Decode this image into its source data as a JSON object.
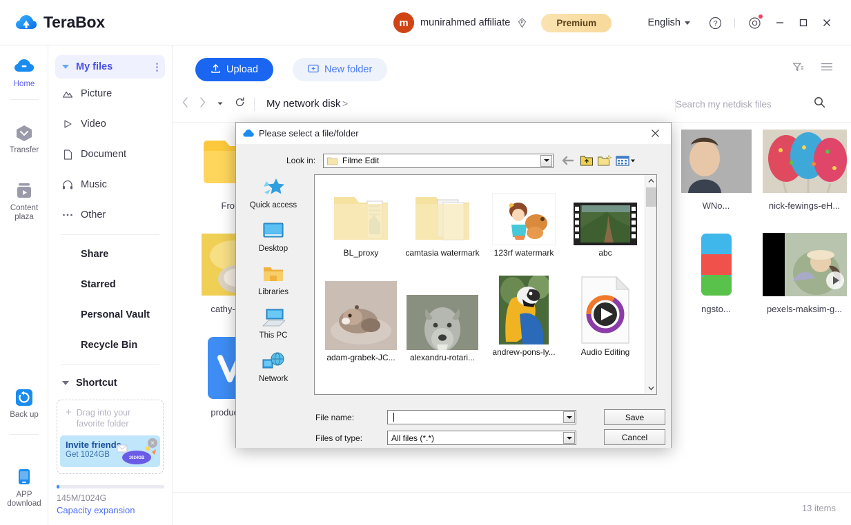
{
  "app": {
    "brand": "TeraBox",
    "brand_color": "#1a8cf0"
  },
  "topbar": {
    "avatar_initial": "m",
    "account_name": "munirahmed affiliate",
    "premium_label": "Premium",
    "language": "English",
    "icons": [
      "help-icon",
      "settings-icon"
    ],
    "window_controls": [
      "minimize",
      "maximize",
      "close"
    ]
  },
  "rail": {
    "items": [
      {
        "label": "Home",
        "icon": "cloud-icon",
        "active": true
      },
      {
        "label": "Transfer",
        "icon": "transfer-icon",
        "active": false
      },
      {
        "label": "Content plaza",
        "icon": "content-plaza-icon",
        "active": false
      },
      {
        "label": "Back up",
        "icon": "backup-icon",
        "active": false
      },
      {
        "label": "APP download",
        "icon": "app-download-icon",
        "active": false
      }
    ]
  },
  "sidebar": {
    "my_files": "My files",
    "categories": [
      {
        "label": "Picture",
        "icon": "picture-icon"
      },
      {
        "label": "Video",
        "icon": "video-icon"
      },
      {
        "label": "Document",
        "icon": "document-icon"
      },
      {
        "label": "Music",
        "icon": "music-icon"
      },
      {
        "label": "Other",
        "icon": "other-icon"
      }
    ],
    "links": [
      "Share",
      "Starred",
      "Personal Vault",
      "Recycle Bin"
    ],
    "shortcut": "Shortcut",
    "dropzone": "Drag into your favorite folder",
    "invite_title": "Invite friends",
    "invite_sub": "Get 1024GB",
    "invite_art_label": "1024GB",
    "capacity_text": "145M/1024G",
    "capacity_link": "Capacity expansion"
  },
  "main": {
    "upload_label": "Upload",
    "new_folder_label": "New folder",
    "filter_icon": "filter-icon",
    "list_view_icon": "list-view-icon",
    "breadcrumb": "My network disk",
    "breadcrumb_arrow": ">",
    "search_placeholder": "Search my netdisk files",
    "search_value": "",
    "items_count": "13 items",
    "files": [
      {
        "name": "From: ",
        "type": "folder"
      },
      {
        "name": "cathy-mu...",
        "type": "image"
      },
      {
        "name": "product c...",
        "type": "image"
      },
      {
        "name": "WNo...",
        "type": "image"
      },
      {
        "name": "ngsto...",
        "type": "image"
      },
      {
        "name": "nick-fewings-eH...",
        "type": "image"
      },
      {
        "name": "pexels-maksim-g...",
        "type": "video"
      }
    ]
  },
  "dialog": {
    "title": "Please select a file/folder",
    "close_icon": "close-icon",
    "look_in_label": "Look in:",
    "look_in_value": "Filme Edit",
    "toolbar_icons": [
      "back-arrow-icon",
      "up-folder-icon",
      "new-folder-icon",
      "views-icon"
    ],
    "places": [
      {
        "label": "Quick access",
        "icon": "quick-access-icon"
      },
      {
        "label": "Desktop",
        "icon": "desktop-icon"
      },
      {
        "label": "Libraries",
        "icon": "libraries-icon"
      },
      {
        "label": "This PC",
        "icon": "this-pc-icon"
      },
      {
        "label": "Network",
        "icon": "network-icon"
      }
    ],
    "files": [
      {
        "name": "BL_proxy",
        "type": "folder"
      },
      {
        "name": "camtasia watermark",
        "type": "folder"
      },
      {
        "name": "123rf watermark",
        "type": "image"
      },
      {
        "name": "abc",
        "type": "video"
      },
      {
        "name": "adam-grabek-JC...",
        "type": "image"
      },
      {
        "name": "alexandru-rotari...",
        "type": "image"
      },
      {
        "name": "andrew-pons-ly...",
        "type": "image"
      },
      {
        "name": "Audio Editing",
        "type": "media-file"
      }
    ],
    "file_name_label": "File name:",
    "file_name_value": "",
    "files_of_type_label": "Files of type:",
    "files_of_type_value": "All files (*.*)",
    "save_label": "Save",
    "cancel_label": "Cancel"
  }
}
